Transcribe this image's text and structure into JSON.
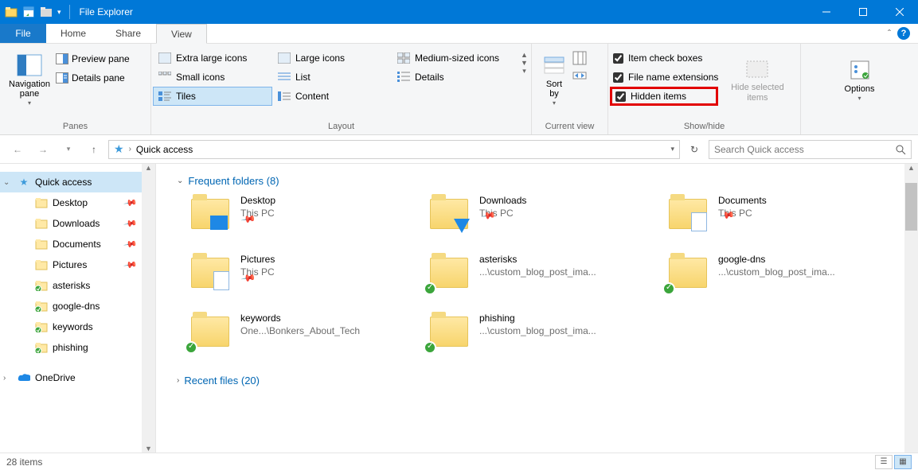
{
  "title": "File Explorer",
  "menu": {
    "file": "File",
    "home": "Home",
    "share": "Share",
    "view": "View"
  },
  "ribbon": {
    "panes": {
      "nav": "Navigation\npane",
      "preview": "Preview pane",
      "details": "Details pane",
      "group": "Panes"
    },
    "layout": {
      "xl": "Extra large icons",
      "l": "Large icons",
      "m": "Medium-sized icons",
      "s": "Small icons",
      "list": "List",
      "det": "Details",
      "tiles": "Tiles",
      "content": "Content",
      "group": "Layout"
    },
    "current": {
      "sort": "Sort\nby",
      "group": "Current view"
    },
    "showhide": {
      "cb1": "Item check boxes",
      "cb2": "File name extensions",
      "cb3": "Hidden items",
      "hide": "Hide selected\nitems",
      "group": "Show/hide"
    },
    "options": "Options"
  },
  "addr": {
    "text": "Quick access",
    "search_placeholder": "Search Quick access"
  },
  "tree": {
    "qa": "Quick access",
    "items": [
      {
        "label": "Desktop",
        "pin": true
      },
      {
        "label": "Downloads",
        "pin": true
      },
      {
        "label": "Documents",
        "pin": true
      },
      {
        "label": "Pictures",
        "pin": true
      },
      {
        "label": "asterisks",
        "sync": true
      },
      {
        "label": "google-dns",
        "sync": true
      },
      {
        "label": "keywords",
        "sync": true
      },
      {
        "label": "phishing",
        "sync": true
      }
    ],
    "onedrive": "OneDrive"
  },
  "sections": {
    "frequent": "Frequent folders (8)",
    "recent": "Recent files (20)"
  },
  "tiles": [
    {
      "name": "Desktop",
      "sub": "This PC",
      "pin": true,
      "overlay": "sq"
    },
    {
      "name": "Downloads",
      "sub": "This PC",
      "pin": true,
      "overlay": "arrow"
    },
    {
      "name": "Documents",
      "sub": "This PC",
      "pin": true,
      "overlay": "doc"
    },
    {
      "name": "Pictures",
      "sub": "This PC",
      "pin": true,
      "overlay": "doc"
    },
    {
      "name": "asterisks",
      "sub": "...\\custom_blog_post_ima...",
      "sync": true
    },
    {
      "name": "google-dns",
      "sub": "...\\custom_blog_post_ima...",
      "sync": true
    },
    {
      "name": "keywords",
      "sub": "One...\\Bonkers_About_Tech",
      "sync": true
    },
    {
      "name": "phishing",
      "sub": "...\\custom_blog_post_ima...",
      "sync": true
    }
  ],
  "status": {
    "count": "28 items"
  }
}
